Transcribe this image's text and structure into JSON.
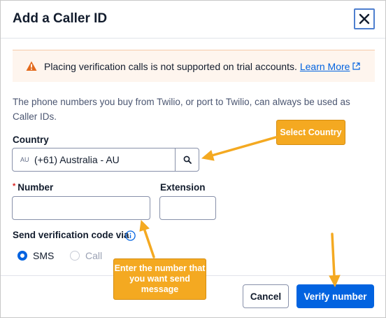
{
  "dialog": {
    "title": "Add a Caller ID"
  },
  "alert": {
    "message": "Placing verification calls is not supported on trial accounts.",
    "link": "Learn More"
  },
  "description": "The phone numbers you buy from Twilio, or port to Twilio, can always be used as Caller IDs.",
  "form": {
    "country_label": "Country",
    "country_code": "AU",
    "country_value": "(+61) Australia - AU",
    "number_label": "Number",
    "number_required_mark": "*",
    "number_value": "",
    "extension_label": "Extension",
    "extension_value": "",
    "send_via_label": "Send verification code via",
    "methods": [
      {
        "label": "SMS",
        "selected": true
      },
      {
        "label": "Call",
        "selected": false
      }
    ]
  },
  "footer": {
    "cancel_label": "Cancel",
    "verify_label": "Verify number"
  },
  "annotations": {
    "select_country": "Select Country",
    "enter_number": "Enter the number that you want send message"
  },
  "colors": {
    "primary": "#0263e0",
    "annotation": "#f4a921",
    "warning": "#e36a1d"
  },
  "icons": [
    "close-icon",
    "warning-icon",
    "external-link-icon",
    "search-icon",
    "info-icon"
  ]
}
